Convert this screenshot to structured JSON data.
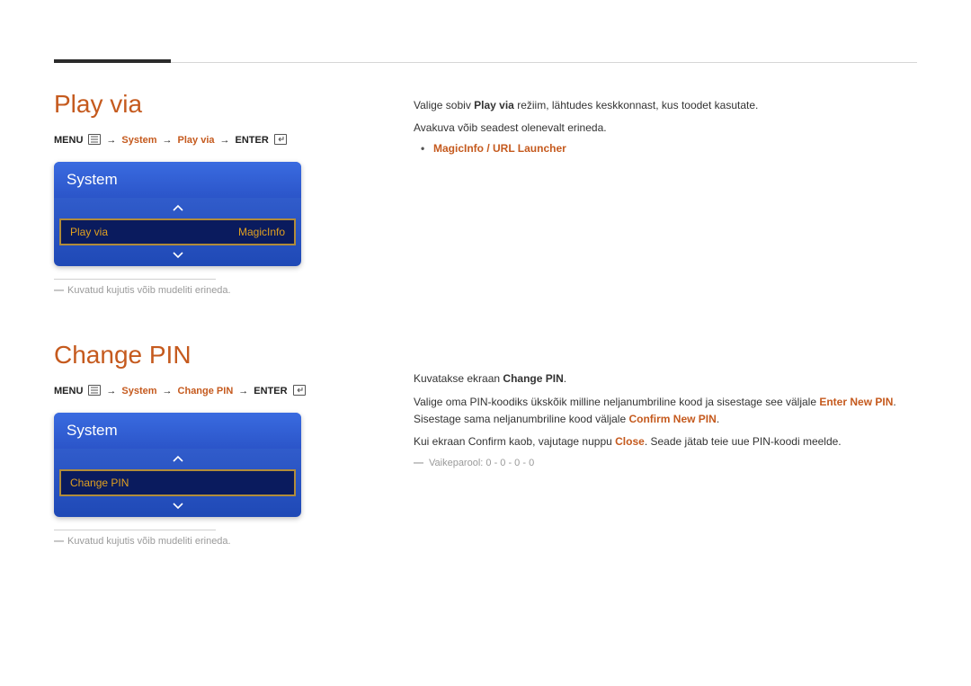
{
  "section1": {
    "title": "Play via",
    "breadcrumb": {
      "p0": "MENU",
      "p1": "System",
      "p2": "Play via",
      "p3": "ENTER"
    },
    "panel": {
      "header": "System",
      "row_label": "Play via",
      "row_value": "MagicInfo"
    },
    "caption": "Kuvatud kujutis võib mudeliti erineda.",
    "desc": {
      "line1_a": "Valige sobiv ",
      "line1_b": "Play via",
      "line1_c": " režiim, lähtudes keskkonnast, kus toodet kasutate.",
      "line2": "Avakuva võib seadest olenevalt erineda.",
      "bullet": "MagicInfo / URL Launcher"
    }
  },
  "section2": {
    "title": "Change PIN",
    "breadcrumb": {
      "p0": "MENU",
      "p1": "System",
      "p2": "Change PIN",
      "p3": "ENTER"
    },
    "panel": {
      "header": "System",
      "row_label": "Change PIN"
    },
    "caption": "Kuvatud kujutis võib mudeliti erineda.",
    "desc": {
      "line1_a": "Kuvatakse ekraan ",
      "line1_b": "Change PIN",
      "line1_c": ".",
      "line2_a": "Valige oma PIN-koodiks ükskõik milline neljanumbriline kood ja sisestage see väljale ",
      "line2_b": "Enter New PIN",
      "line2_c": ". Sisestage sama neljanumbriline kood väljale ",
      "line2_d": "Confirm New PIN",
      "line2_e": ".",
      "line3_a": "Kui ekraan Confirm kaob, vajutage nuppu ",
      "line3_b": "Close",
      "line3_c": ". Seade jätab teie uue PIN-koodi meelde.",
      "note": "Vaikeparool: 0 - 0 - 0 - 0"
    }
  },
  "glyphs": {
    "arrow": "→",
    "tick": "―"
  }
}
